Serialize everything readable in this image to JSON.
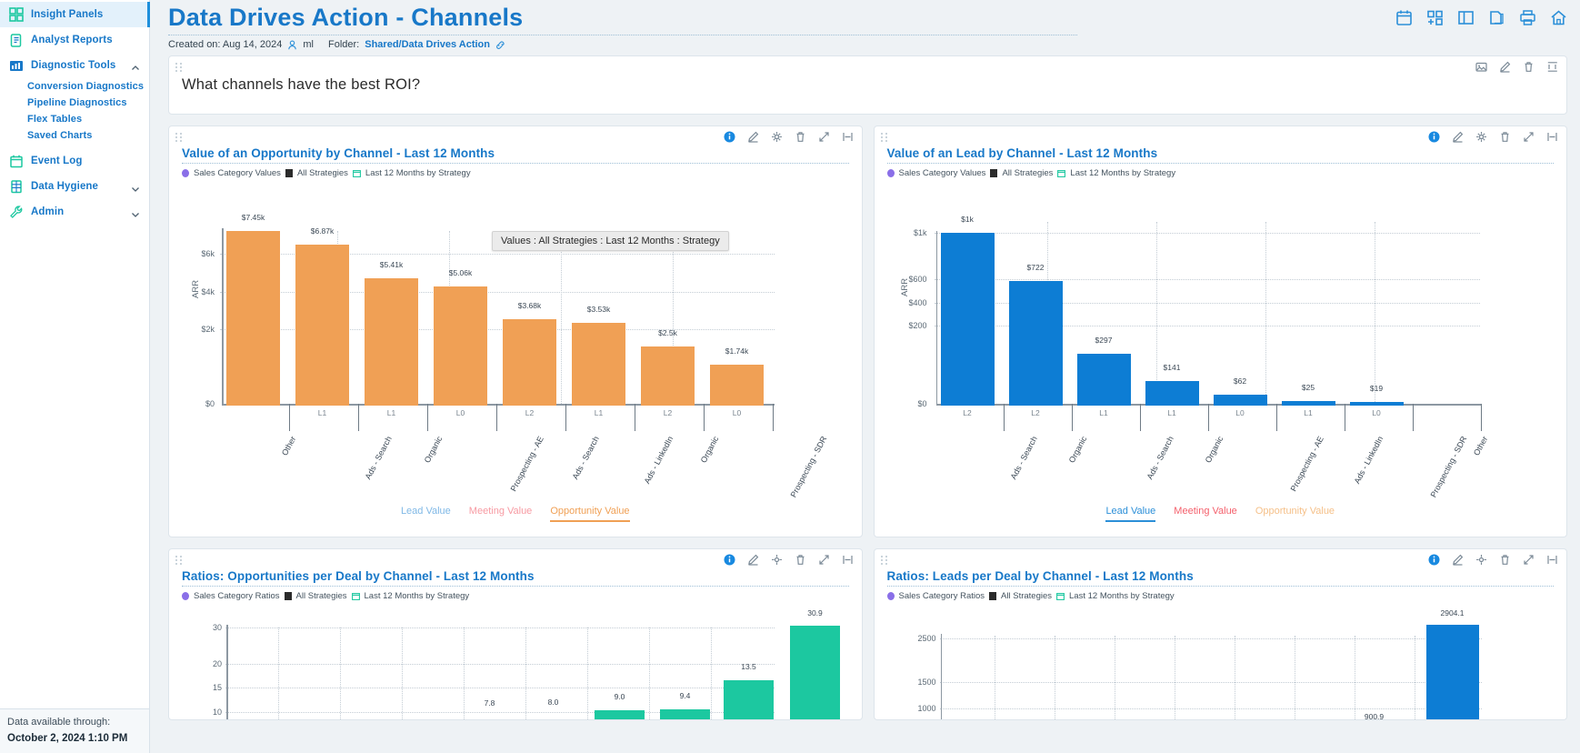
{
  "sidebar": {
    "items": [
      {
        "label": "Insight Panels",
        "icon": "grid-panels-icon",
        "active": true,
        "caret": null
      },
      {
        "label": "Analyst Reports",
        "icon": "report-clipboard-icon",
        "active": false,
        "caret": null
      },
      {
        "label": "Diagnostic Tools",
        "icon": "bar-chart-icon",
        "active": false,
        "caret": "up"
      },
      {
        "label": "Event Log",
        "icon": "calendar-icon",
        "active": false,
        "caret": null
      },
      {
        "label": "Data Hygiene",
        "icon": "database-icon",
        "active": false,
        "caret": "down"
      },
      {
        "label": "Admin",
        "icon": "wrench-icon",
        "active": false,
        "caret": "down"
      }
    ],
    "sub_items": [
      {
        "label": "Conversion Diagnostics"
      },
      {
        "label": "Pipeline Diagnostics"
      },
      {
        "label": "Flex Tables"
      },
      {
        "label": "Saved Charts"
      }
    ],
    "footer": {
      "label": "Data available through:",
      "value": "October 2, 2024 1:10 PM"
    }
  },
  "header": {
    "title": "Data Drives Action - Channels",
    "created_label": "Created on: Aug 14, 2024",
    "user_icon": "user-icon",
    "user": "ml",
    "folder_label": "Folder:",
    "folder_value": "Shared/Data Drives Action",
    "link_icon": "link-icon",
    "icons": [
      {
        "name": "calendar-icon"
      },
      {
        "name": "add-panel-icon"
      },
      {
        "name": "layout-icon"
      },
      {
        "name": "duplicate-icon"
      },
      {
        "name": "print-icon"
      },
      {
        "name": "home-icon"
      }
    ]
  },
  "text_panel": {
    "question": "What channels have the best ROI?",
    "tools": [
      {
        "name": "image-icon"
      },
      {
        "name": "edit-icon"
      },
      {
        "name": "delete-icon"
      },
      {
        "name": "resize-icon"
      }
    ]
  },
  "panel_tools": [
    {
      "name": "info-icon"
    },
    {
      "name": "edit-icon"
    },
    {
      "name": "share-icon"
    },
    {
      "name": "delete-icon"
    },
    {
      "name": "expand-icon"
    },
    {
      "name": "collapse-icon"
    }
  ],
  "legend": {
    "values_text": "Sales Category  Values",
    "ratios_text": "Sales Category  Ratios",
    "strategy_text": "All Strategies",
    "period_text": "Last 12 Months  by Strategy"
  },
  "tooltip": {
    "text": "Values : All Strategies : Last 12 Months : Strategy"
  },
  "tabs": {
    "lead": "Lead Value",
    "meeting": "Meeting Value",
    "opportunity": "Opportunity Value"
  },
  "colors": {
    "orange": "#f0a055",
    "blue": "#0d7dd4",
    "teal": "#1cc8a0",
    "link_blue": "#1878c8",
    "tab_red": "#f4606c"
  },
  "chart_data": [
    {
      "id": "opportunity-value",
      "type": "bar",
      "title": "Value of an Opportunity by Channel - Last 12 Months",
      "xlabel": "",
      "ylabel": "ARR",
      "ylim": [
        0,
        7800
      ],
      "yticks": [
        0,
        2000,
        4000,
        6000
      ],
      "ytick_labels": [
        "$0",
        "$2k",
        "$4k",
        "$6k"
      ],
      "grid": true,
      "color": "#f0a055",
      "categories": [
        "Other",
        "Ads - Search",
        "Organic",
        "Prospecting - AE",
        "Ads - Search",
        "Ads - LinkedIn",
        "Organic",
        "Prospecting - SDR"
      ],
      "levels": [
        "",
        "L1",
        "L1",
        "L0",
        "L2",
        "L1",
        "L2",
        "L0"
      ],
      "values": [
        7450,
        6870,
        5410,
        5060,
        3680,
        3530,
        2500,
        1740
      ],
      "value_labels": [
        "$7.45k",
        "$6.87k",
        "$5.41k",
        "$5.06k",
        "$3.68k",
        "$3.53k",
        "$2.5k",
        "$1.74k"
      ],
      "active_tab": "opportunity"
    },
    {
      "id": "lead-value",
      "type": "bar",
      "title": "Value of an Lead by Channel - Last 12 Months",
      "xlabel": "",
      "ylabel": "ARR",
      "ylim": [
        0,
        1060
      ],
      "yticks": [
        0,
        200,
        400,
        600,
        1000
      ],
      "ytick_labels": [
        "$0",
        "$200",
        "$400",
        "$600",
        "$1k"
      ],
      "grid": true,
      "color": "#0d7dd4",
      "categories": [
        "Ads - Search",
        "Organic",
        "Ads - Search",
        "Organic",
        "Prospecting - AE",
        "Ads - LinkedIn",
        "Prospecting - SDR",
        "Other"
      ],
      "levels": [
        "L2",
        "L2",
        "L1",
        "L1",
        "L0",
        "L1",
        "L0",
        ""
      ],
      "values": [
        1000,
        722,
        297,
        141,
        62,
        25,
        19,
        0
      ],
      "value_labels": [
        "$1k",
        "$722",
        "$297",
        "$141",
        "$62",
        "$25",
        "$19",
        ""
      ],
      "active_tab": "lead"
    },
    {
      "id": "opportunities-per-deal",
      "type": "bar",
      "title": "Ratios: Opportunities per Deal by Channel - Last 12 Months",
      "xlabel": "",
      "ylabel": "",
      "ylim": [
        0,
        33
      ],
      "yticks": [
        10,
        15,
        20,
        30
      ],
      "ytick_labels": [
        "10",
        "15",
        "20",
        "30"
      ],
      "grid": true,
      "color": "#1cc8a0",
      "categories": [
        "",
        "",
        "",
        "",
        "",
        "",
        "",
        ""
      ],
      "values": [
        0,
        0,
        7.8,
        8.0,
        9.0,
        9.4,
        13.5,
        30.9
      ],
      "value_labels": [
        "",
        "",
        "7.8",
        "8.0",
        "9.0",
        "9.4",
        "13.5",
        "30.9"
      ],
      "active_tab": "opportunity"
    },
    {
      "id": "leads-per-deal",
      "type": "bar",
      "title": "Ratios: Leads per Deal by Channel - Last 12 Months",
      "xlabel": "",
      "ylabel": "",
      "ylim": [
        0,
        3000
      ],
      "yticks": [
        1000,
        1500,
        2500
      ],
      "ytick_labels": [
        "1000",
        "1500",
        "2500"
      ],
      "grid": true,
      "color": "#0d7dd4",
      "categories": [
        "",
        "",
        "",
        "",
        "",
        "",
        "",
        ""
      ],
      "values": [
        0,
        0,
        0,
        0,
        0,
        0,
        900.9,
        2904.1
      ],
      "value_labels": [
        "",
        "",
        "",
        "",
        "",
        "",
        "900.9",
        "2904.1"
      ],
      "active_tab": "lead"
    }
  ]
}
